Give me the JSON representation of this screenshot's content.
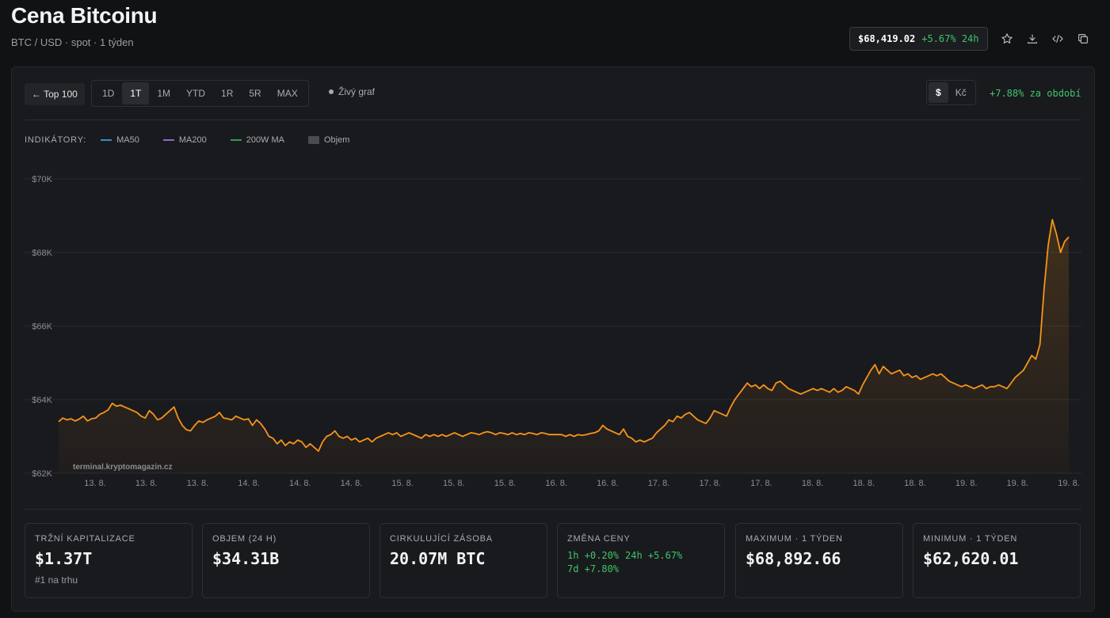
{
  "header": {
    "title": "Cena Bitcoinu",
    "subtitle": "BTC / USD · spot · 1 týden",
    "ticker_price": "$68,419.02",
    "ticker_change": "+5.67% 24h",
    "icons": [
      "star-icon",
      "download-icon",
      "code-icon",
      "copy-icon"
    ]
  },
  "toolbar": {
    "back_label": "← Top 100",
    "ranges": [
      "1D",
      "1T",
      "1M",
      "YTD",
      "1R",
      "5R",
      "MAX"
    ],
    "active_range": "1T",
    "live_label": "Živý graf",
    "currencies": [
      "$",
      "Kč"
    ],
    "active_currency": "$",
    "period_change": "+7.88% za období"
  },
  "indicators": {
    "label": "INDIKÁTORY:",
    "items": [
      {
        "name": "MA50",
        "color": "#3b8fc4"
      },
      {
        "name": "MA200",
        "color": "#8a6cc4"
      },
      {
        "name": "200W MA",
        "color": "#2f9a55"
      },
      {
        "name": "Objem",
        "color": "#4a4b4f"
      }
    ]
  },
  "watermark": "terminal.kryptomagazin.cz",
  "chart_data": {
    "type": "area",
    "title": "",
    "xlabel": "",
    "ylabel": "",
    "ylim": [
      62000,
      70000
    ],
    "y_ticks": [
      62000,
      64000,
      66000,
      68000,
      70000
    ],
    "y_tick_labels": [
      "$62K",
      "$64K",
      "$66K",
      "$68K",
      "$70K"
    ],
    "x_tick_labels": [
      "13. 8.",
      "13. 8.",
      "13. 8.",
      "14. 8.",
      "14. 8.",
      "14. 8.",
      "15. 8.",
      "15. 8.",
      "15. 8.",
      "16. 8.",
      "16. 8.",
      "17. 8.",
      "17. 8.",
      "17. 8.",
      "18. 8.",
      "18. 8.",
      "18. 8.",
      "19. 8.",
      "19. 8.",
      "19. 8."
    ],
    "line_color": "#f7931a",
    "grid": true,
    "series": [
      {
        "values": [
          63400,
          63500,
          63450,
          63480,
          63420,
          63470,
          63550,
          63420,
          63480,
          63500,
          63600,
          63650,
          63720,
          63900,
          63820,
          63850,
          63800,
          63750,
          63700,
          63650,
          63550,
          63500,
          63700,
          63600,
          63450,
          63500,
          63600,
          63700,
          63800,
          63500,
          63300,
          63180,
          63150,
          63300,
          63420,
          63380,
          63450,
          63500,
          63550,
          63650,
          63500,
          63480,
          63450,
          63550,
          63500,
          63450,
          63480,
          63300,
          63450,
          63350,
          63200,
          63000,
          62950,
          62800,
          62900,
          62750,
          62850,
          62800,
          62900,
          62850,
          62700,
          62800,
          62700,
          62600,
          62850,
          63000,
          63050,
          63150,
          63000,
          62950,
          63000,
          62900,
          62950,
          62850,
          62900,
          62950,
          62850,
          62950,
          63000,
          63050,
          63100,
          63050,
          63100,
          63000,
          63050,
          63100,
          63050,
          63000,
          62950,
          63050,
          63000,
          63050,
          63000,
          63050,
          63000,
          63050,
          63100,
          63050,
          63000,
          63050,
          63100,
          63080,
          63050,
          63100,
          63130,
          63100,
          63050,
          63100,
          63080,
          63050,
          63100,
          63050,
          63080,
          63050,
          63100,
          63080,
          63050,
          63100,
          63080,
          63050,
          63050,
          63050,
          63050,
          63000,
          63050,
          63000,
          63050,
          63030,
          63050,
          63080,
          63100,
          63150,
          63300,
          63200,
          63150,
          63100,
          63050,
          63200,
          63000,
          62950,
          62850,
          62900,
          62850,
          62900,
          62950,
          63100,
          63200,
          63300,
          63450,
          63400,
          63550,
          63500,
          63600,
          63650,
          63550,
          63450,
          63400,
          63350,
          63500,
          63700,
          63650,
          63600,
          63550,
          63800,
          64000,
          64150,
          64300,
          64450,
          64350,
          64400,
          64300,
          64400,
          64300,
          64250,
          64450,
          64500,
          64400,
          64300,
          64250,
          64200,
          64150,
          64200,
          64250,
          64300,
          64250,
          64300,
          64250,
          64200,
          64300,
          64200,
          64250,
          64350,
          64300,
          64250,
          64150,
          64400,
          64600,
          64800,
          64950,
          64700,
          64900,
          64800,
          64700,
          64750,
          64800,
          64650,
          64700,
          64600,
          64650,
          64550,
          64600,
          64650,
          64700,
          64650,
          64700,
          64600,
          64500,
          64450,
          64400,
          64350,
          64400,
          64350,
          64300,
          64350,
          64400,
          64300,
          64350,
          64350,
          64400,
          64350,
          64300,
          64450,
          64600,
          64700,
          64800,
          65000,
          65200,
          65100,
          65500,
          67000,
          68200,
          68892,
          68500,
          68000,
          68300,
          68419
        ]
      }
    ]
  },
  "stats": [
    {
      "label": "TRŽNÍ KAPITALIZACE",
      "value": "$1.37T",
      "sub": "#1 na trhu"
    },
    {
      "label": "OBJEM (24 H)",
      "value": "$34.31B"
    },
    {
      "label": "CIRKULUJÍCÍ ZÁSOBA",
      "value": "20.07M BTC"
    },
    {
      "label": "ZMĚNA CENY",
      "changes": [
        "1h +0.20%",
        "24h +5.67%",
        "7d +7.80%"
      ]
    },
    {
      "label": "MAXIMUM · 1 TÝDEN",
      "value": "$68,892.66"
    },
    {
      "label": "MINIMUM · 1 TÝDEN",
      "value": "$62,620.01"
    }
  ]
}
